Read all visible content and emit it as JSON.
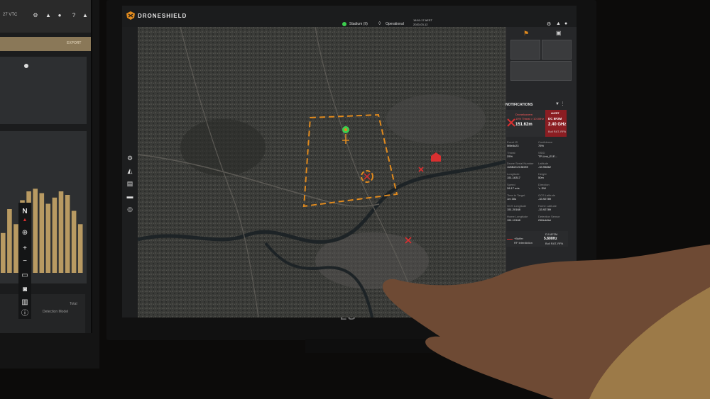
{
  "left_monitor": {
    "topbar_text": "27 VTC",
    "gold_bar_label": "EXPORT",
    "table_header": "Detection Model",
    "table_col": "Total",
    "bar_heights": [
      0.45,
      0.72,
      0.55,
      0.82,
      0.92,
      0.95,
      0.9,
      0.78,
      0.85,
      0.92,
      0.88,
      0.7,
      0.55
    ]
  },
  "app": {
    "brand": "DRONESHIELD",
    "site": "Stadium (II)",
    "status": "Operational",
    "time_line1": "18:51:17 AEST",
    "time_line2": "2020-03-12"
  },
  "map_controls": {
    "north": "N",
    "zoom_in": "+",
    "zoom_out": "−"
  },
  "notifications": {
    "header": "NOTIFICATIONS",
    "alert": {
      "name": "DroneIcovern",
      "sub": "10% Threat > 10.00Hz",
      "distance": "151.62m",
      "badge": "ALERT",
      "model": "DC 8F2M",
      "freq": "2.40 GHz",
      "extra": "Bull RAT..RPA"
    },
    "fields": [
      {
        "label": "Event ID",
        "value": "5f8e8c23"
      },
      {
        "label": "Confidence",
        "value": "75%"
      },
      {
        "label": "Threat",
        "value": "25%"
      },
      {
        "label": "SSID",
        "value": "TP-Link_E1E..."
      },
      {
        "label": "Drone Serial Number",
        "value": "11BB2C2C5DEE"
      },
      {
        "label": "Latitude",
        "value": "-33.95862"
      },
      {
        "label": "Longitude",
        "value": "151.16317"
      },
      {
        "label": "Height",
        "value": "50m"
      },
      {
        "label": "Speed",
        "value": "28.17 m/s"
      },
      {
        "label": "Direction",
        "value": "↘ SW"
      },
      {
        "label": "Time to Target",
        "value": "1m 30s"
      },
      {
        "label": "GCS Latitude",
        "value": "-33.92789"
      },
      {
        "label": "GCS Longitude",
        "value": "151.20168"
      },
      {
        "label": "Home Latitude",
        "value": "-33.92789"
      },
      {
        "label": "Home Longitude",
        "value": "151.19168"
      },
      {
        "label": "Detection Sensor",
        "value": "OtMobilist"
      }
    ],
    "footer": {
      "left1": "+Buffer",
      "left2": "RF Interdiction",
      "right1": "DJI 8F2M",
      "right2": "5.800Hz",
      "right3": "Bull RAT..RPA"
    }
  },
  "colors": {
    "accent": "#e08a1e",
    "alert_red": "#8b1d22",
    "online_green": "#3ccf4e"
  }
}
